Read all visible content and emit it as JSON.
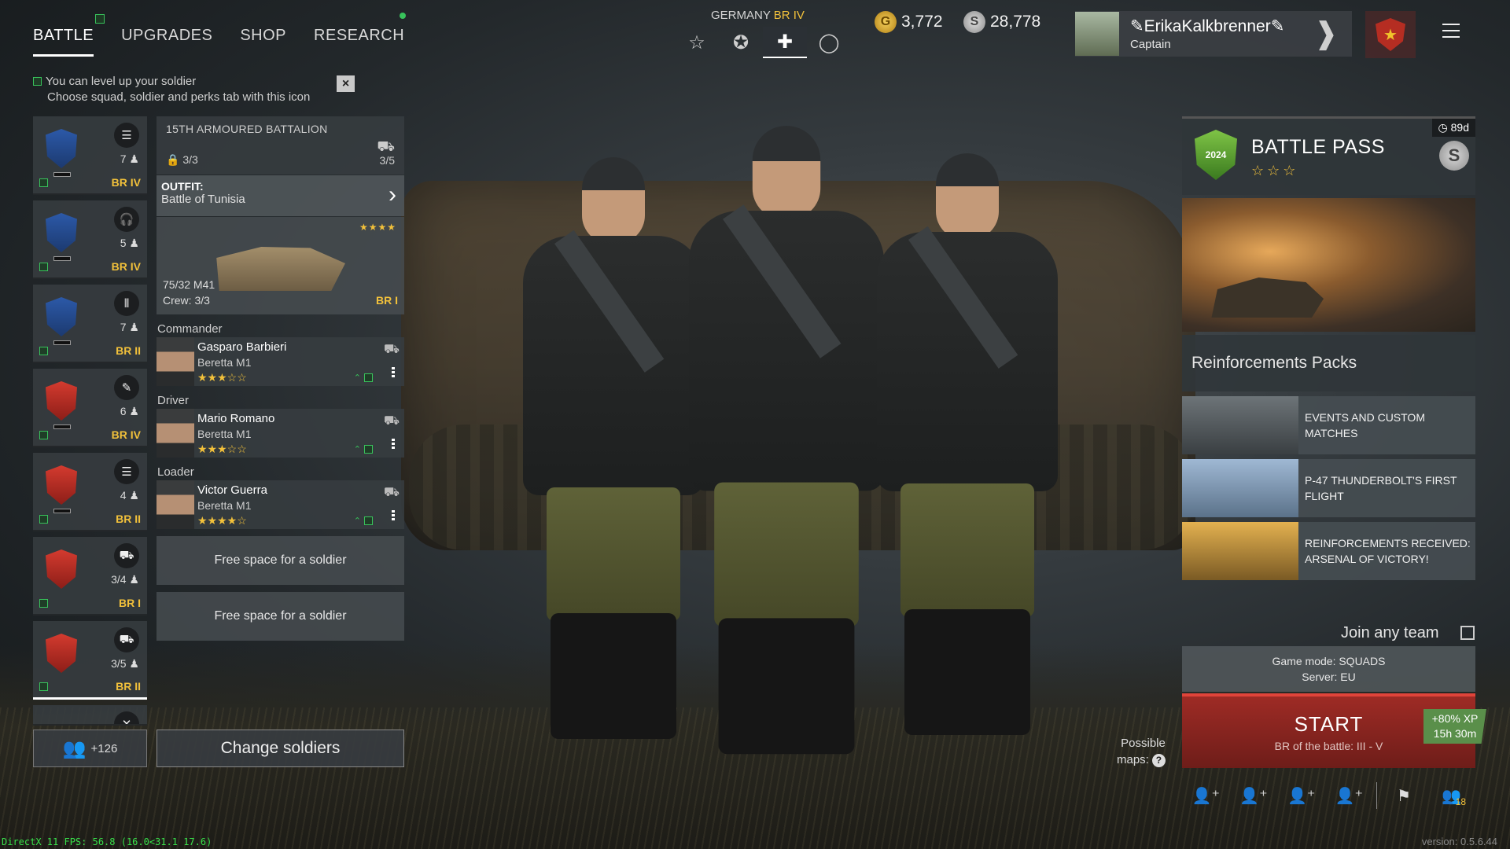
{
  "nav": {
    "tabs": [
      {
        "label": "BATTLE",
        "active": true
      },
      {
        "label": "UPGRADES",
        "active": false
      },
      {
        "label": "SHOP",
        "active": false
      },
      {
        "label": "RESEARCH",
        "active": false
      }
    ]
  },
  "hint": {
    "line1": "You can level up your soldier",
    "line2": "Choose squad, soldier and perks tab with this icon",
    "close_label": "×"
  },
  "nation": {
    "label": "GERMANY",
    "br": "BR IV"
  },
  "currency": {
    "gold": "3,772",
    "silver": "28,778"
  },
  "profile": {
    "name": "ErikaKalkbrenner",
    "rank": "Captain"
  },
  "squads": [
    {
      "count": "7",
      "br": "BR IV",
      "emblem": "blue",
      "class_icon": "list-icon"
    },
    {
      "count": "5",
      "br": "BR IV",
      "emblem": "blue",
      "class_icon": "headset-icon"
    },
    {
      "count": "7",
      "br": "BR II",
      "emblem": "blue",
      "class_icon": "ammo-icon"
    },
    {
      "count": "6",
      "br": "BR IV",
      "emblem": "red",
      "class_icon": "wrench-icon"
    },
    {
      "count": "4",
      "br": "BR II",
      "emblem": "red",
      "class_icon": "list-icon"
    },
    {
      "count": "3/4",
      "br": "BR I",
      "emblem": "red",
      "class_icon": "tank-icon"
    },
    {
      "count": "3/5",
      "br": "BR II",
      "emblem": "red",
      "class_icon": "tank-icon"
    }
  ],
  "squad_bottom": {
    "reserve": "+126"
  },
  "detail": {
    "battalion": "15TH ARMOURED BATTALION",
    "crew_count": "3/3",
    "vehicle_count": "3/5",
    "outfit_label": "OUTFIT:",
    "outfit_value": "Battle of Tunisia",
    "vehicle": {
      "name": "75/32 M41",
      "crew": "Crew: 3/3",
      "br": "BR I",
      "stars": "★★★★"
    },
    "members": [
      {
        "role": "Commander",
        "name": "Gasparo Barbieri",
        "weapon": "Beretta M1",
        "stars": "★★★☆☆"
      },
      {
        "role": "Driver",
        "name": "Mario Romano",
        "weapon": "Beretta M1",
        "stars": "★★★☆☆"
      },
      {
        "role": "Loader",
        "name": "Victor Guerra",
        "weapon": "Beretta M1",
        "stars": "★★★★☆"
      }
    ],
    "free_slot_1": "Free space for a soldier",
    "free_slot_2": "Free space for a soldier",
    "change_label": "Change soldiers"
  },
  "battle_pass": {
    "title": "BATTLE PASS",
    "timer": "89d",
    "year": "2024",
    "stars": "☆☆☆"
  },
  "reinforcements": {
    "title": "Reinforcements Packs"
  },
  "packs": [
    {
      "title": "EVENTS AND CUSTOM MATCHES"
    },
    {
      "title": "P-47 THUNDERBOLT'S FIRST FLIGHT"
    },
    {
      "title": "REINFORCEMENTS RECEIVED: ARSENAL OF VICTORY!"
    }
  ],
  "join": {
    "label": "Join any team"
  },
  "mode": {
    "line1": "Game mode: SQUADS",
    "line2": "Server: EU"
  },
  "start": {
    "label": "START",
    "br": "BR of the battle: III - V"
  },
  "xp": {
    "line1": "+80% XP",
    "line2": "15h 30m"
  },
  "maps": {
    "line1": "Possible",
    "line2": "maps:"
  },
  "actions": {
    "count": "18"
  },
  "fps": "DirectX 11 FPS: 56.8 (16.0<31.1 17.6)",
  "version": "version: 0.5.6.44",
  "colors": {
    "accent_gold": "#f2c13b",
    "green_check": "#38c25b",
    "start_red": "#9e2b25"
  }
}
